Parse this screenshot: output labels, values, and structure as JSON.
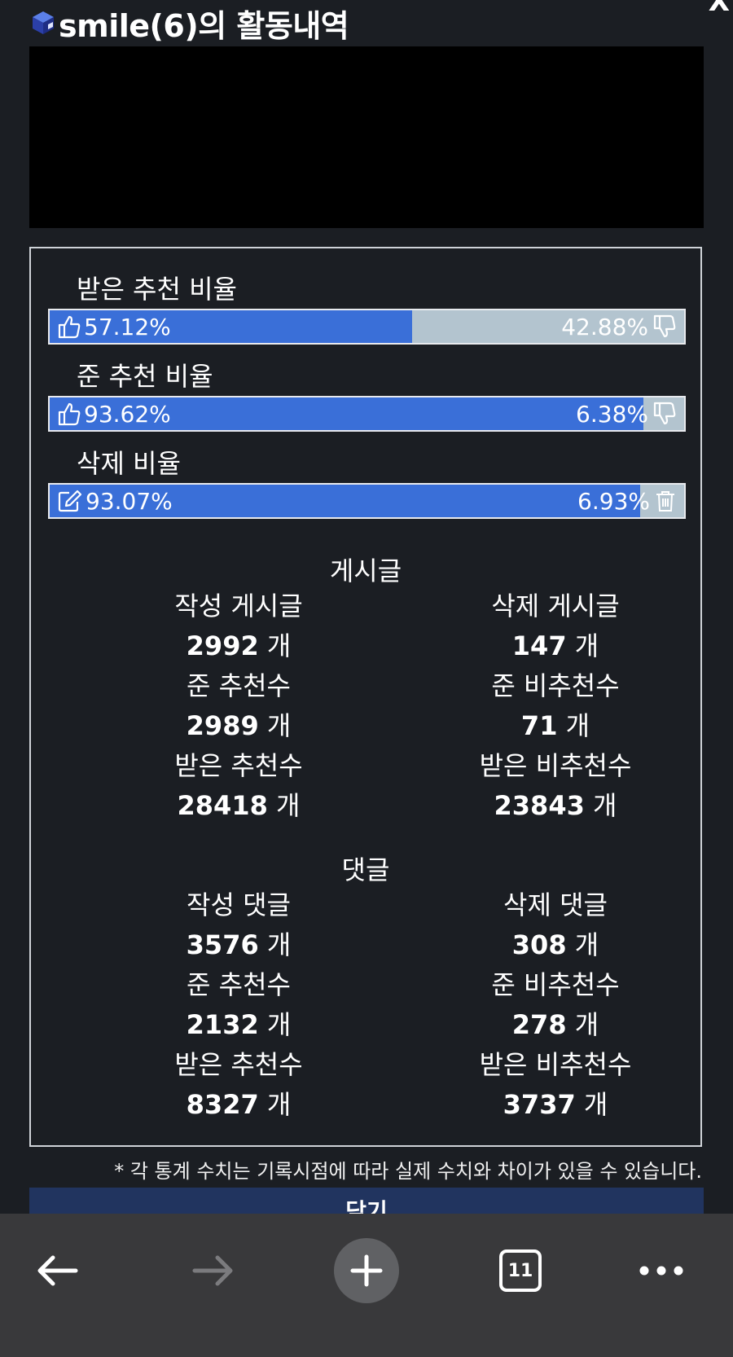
{
  "header": {
    "title": "smile(6)의 활동내역",
    "close_label": "X"
  },
  "ratios": [
    {
      "label": "받은 추천 비율",
      "left_value": "57.12%",
      "right_value": "42.88%",
      "fill": 0.5712,
      "left_icon": "thumbs-up-icon",
      "right_icon": "thumbs-down-icon"
    },
    {
      "label": "준 추천 비율",
      "left_value": "93.62%",
      "right_value": "6.38%",
      "fill": 0.9362,
      "left_icon": "thumbs-up-icon",
      "right_icon": "thumbs-down-icon"
    },
    {
      "label": "삭제 비율",
      "left_value": "93.07%",
      "right_value": "6.93%",
      "fill": 0.9307,
      "left_icon": "edit-icon",
      "right_icon": "trash-icon"
    }
  ],
  "unit": "개",
  "posts": {
    "title": "게시글",
    "written_label": "작성 게시글",
    "written_value": "2992",
    "deleted_label": "삭제 게시글",
    "deleted_value": "147",
    "given_up_label": "준 추천수",
    "given_up_value": "2989",
    "given_down_label": "준 비추천수",
    "given_down_value": "71",
    "received_up_label": "받은 추천수",
    "received_up_value": "28418",
    "received_down_label": "받은 비추천수",
    "received_down_value": "23843"
  },
  "comments": {
    "title": "댓글",
    "written_label": "작성 댓글",
    "written_value": "3576",
    "deleted_label": "삭제 댓글",
    "deleted_value": "308",
    "given_up_label": "준 추천수",
    "given_up_value": "2132",
    "given_down_label": "준 비추천수",
    "given_down_value": "278",
    "received_up_label": "받은 추천수",
    "received_up_value": "8327",
    "received_down_label": "받은 비추천수",
    "received_down_value": "3737"
  },
  "disclaimer": "* 각 통계 수치는 기록시점에 따라 실제 수치와 차이가 있을 수 있습니다.",
  "close_button_label": "닫기",
  "browser": {
    "tab_count": "11"
  },
  "colors": {
    "bar_fill": "#3a6fd8",
    "bar_track": "#b3c4cf",
    "background": "#1b1e23",
    "close_button": "#21345f",
    "toolbar": "#39393b"
  }
}
